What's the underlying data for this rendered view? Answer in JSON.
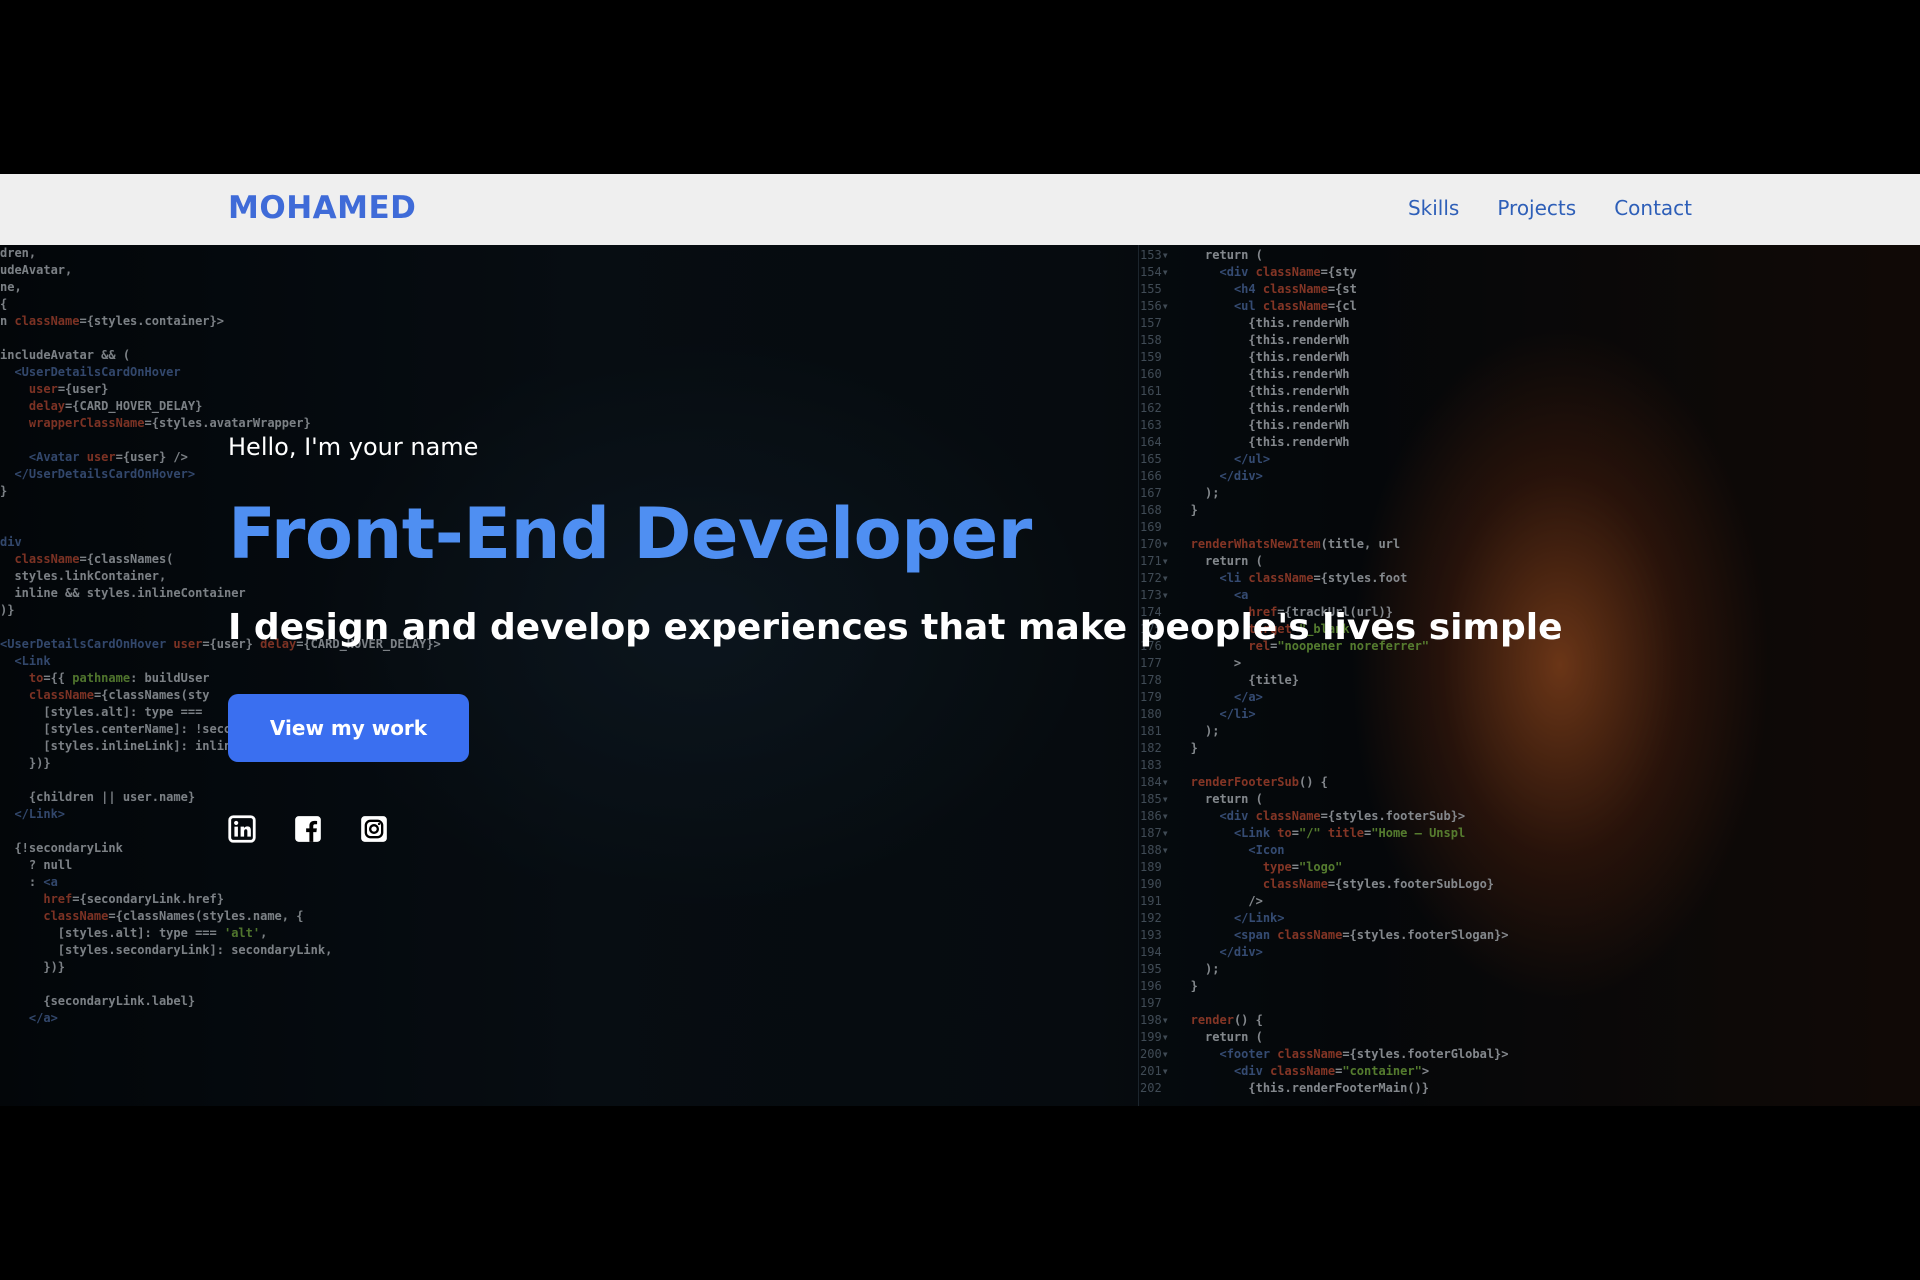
{
  "nav": {
    "brand": "MOHAMED",
    "links": [
      {
        "label": "Skills"
      },
      {
        "label": "Projects"
      },
      {
        "label": "Contact"
      }
    ]
  },
  "hero": {
    "greeting": "Hello, I'm your name",
    "role": "Front-End Developer",
    "tagline": "I design and develop experiences that make people's lives simple",
    "cta_label": "View my work",
    "socials": [
      {
        "icon": "linkedin-icon"
      },
      {
        "icon": "facebook-icon"
      },
      {
        "icon": "instagram-icon"
      }
    ],
    "colors": {
      "brand": "#3f6bd8",
      "role": "#4f8ff2",
      "cta": "#3a6ff0",
      "nav_bg": "#efefef"
    }
  }
}
